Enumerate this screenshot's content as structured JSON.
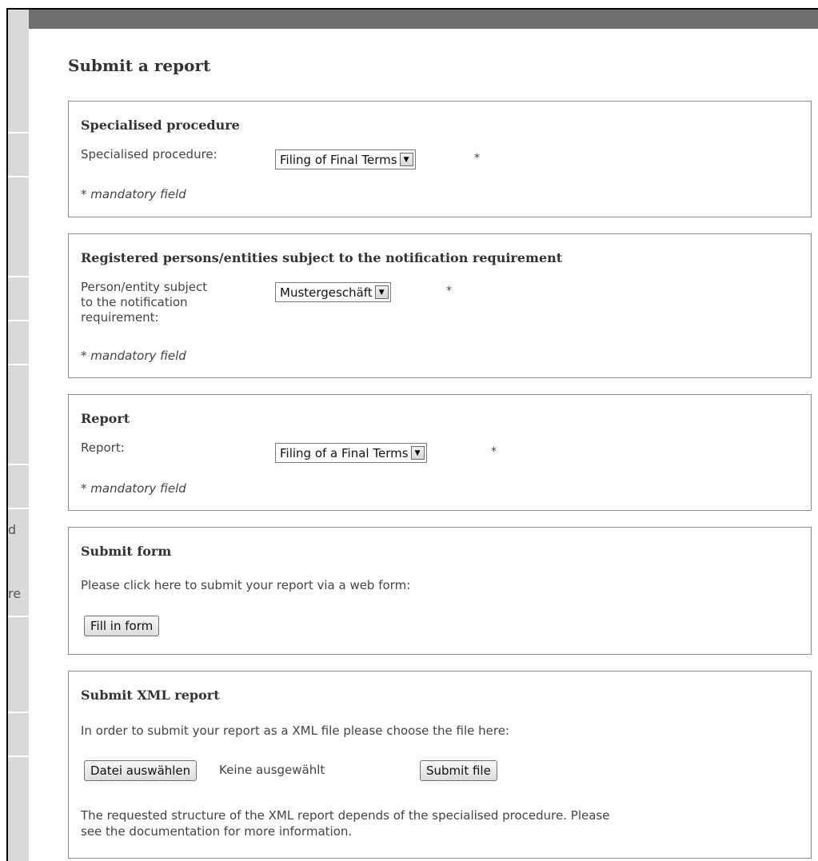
{
  "sidebar": {
    "fragments": [
      "d",
      "re"
    ]
  },
  "page": {
    "title": "Submit a report"
  },
  "procedure_panel": {
    "title": "Specialised procedure",
    "label": "Specialised procedure:",
    "selected": "Filing of Final Terms",
    "required_mark": "*",
    "mandatory_note": "* mandatory field"
  },
  "entity_panel": {
    "title": "Registered persons/entities subject to the notification requirement",
    "label_lines": [
      "Person/entity subject",
      "to the notification",
      "requirement:"
    ],
    "selected": "Mustergeschäft",
    "required_mark": "*",
    "mandatory_note": "* mandatory field"
  },
  "report_panel": {
    "title": "Report",
    "label": "Report:",
    "selected": "Filing of a Final Terms",
    "required_mark": "*",
    "mandatory_note": "* mandatory field"
  },
  "form_panel": {
    "title": "Submit form",
    "text": "Please click here to submit your report via a web form:",
    "button": "Fill in form"
  },
  "xml_panel": {
    "title": "Submit XML report",
    "text": "In order to submit your report as a XML file please choose the file here:",
    "choose_button": "Datei auswählen",
    "file_status": "Keine ausgewählt",
    "submit_button": "Submit file",
    "note_lines": [
      "The requested structure of the XML report depends of the specialised procedure. Please",
      "see the documentation for more information."
    ]
  },
  "icons": {
    "dropdown": "chevron-down-icon"
  }
}
